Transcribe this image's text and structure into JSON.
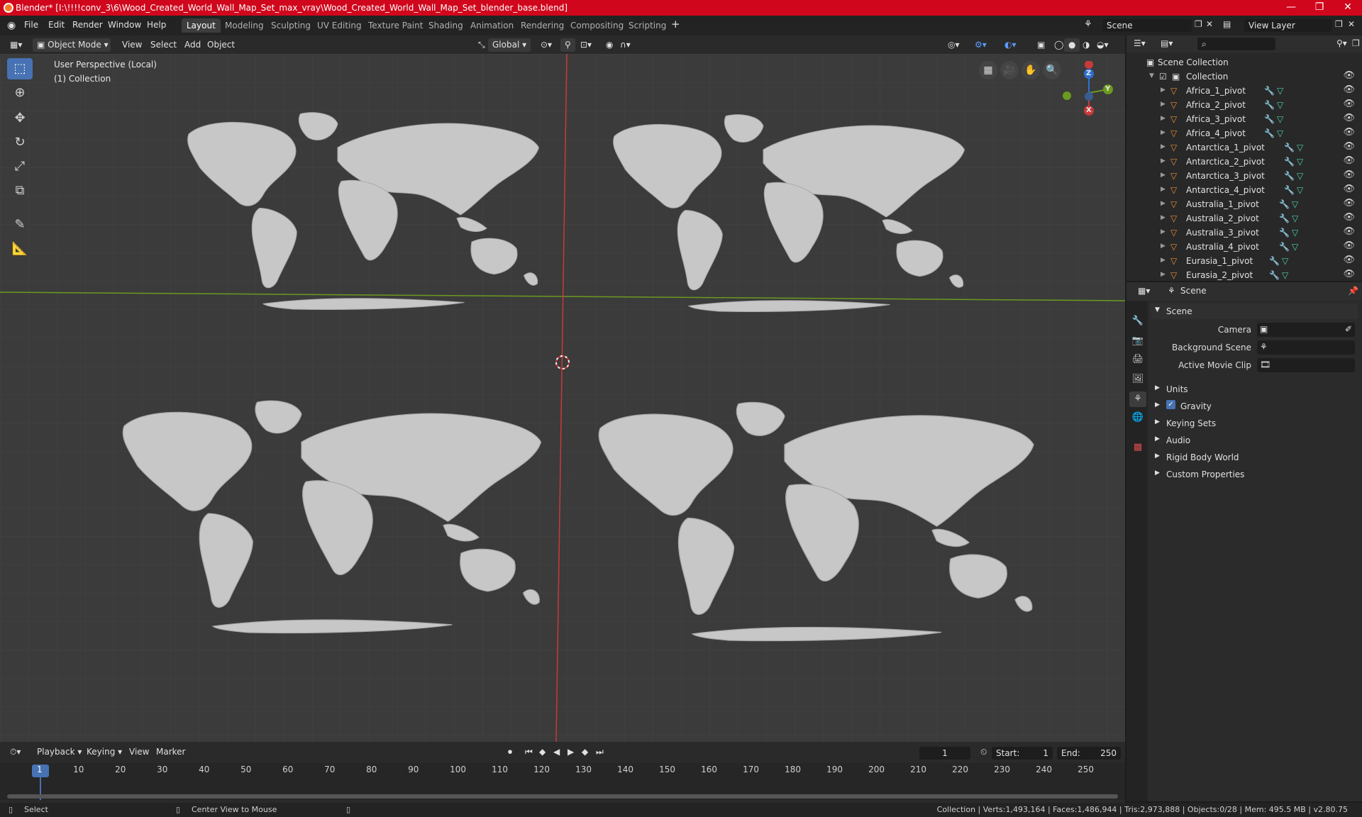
{
  "titlebar": {
    "title": "Blender* [I:\\!!!!conv_3\\6\\Wood_Created_World_Wall_Map_Set_max_vray\\Wood_Created_World_Wall_Map_Set_blender_base.blend]",
    "minimize": "—",
    "maximize": "❐",
    "close": "✕"
  },
  "menu": {
    "file": "File",
    "edit": "Edit",
    "render": "Render",
    "window": "Window",
    "help": "Help"
  },
  "workspaces": [
    "Layout",
    "Modeling",
    "Sculpting",
    "UV Editing",
    "Texture Paint",
    "Shading",
    "Animation",
    "Rendering",
    "Compositing",
    "Scripting"
  ],
  "scene_field": "Scene",
  "view_layer_field": "View Layer",
  "viewport_header": {
    "mode": "Object Mode",
    "view": "View",
    "select": "Select",
    "add": "Add",
    "object": "Object",
    "orientation": "Global"
  },
  "viewport": {
    "perspective_label": "User Perspective (Local)",
    "collection_label": "(1) Collection",
    "gizmo_z": "Z",
    "gizmo_y": "Y",
    "gizmo_x": "X"
  },
  "outliner": {
    "root": "Scene Collection",
    "collection": "Collection",
    "items": [
      "Africa_1_pivot",
      "Africa_2_pivot",
      "Africa_3_pivot",
      "Africa_4_pivot",
      "Antarctica_1_pivot",
      "Antarctica_2_pivot",
      "Antarctica_3_pivot",
      "Antarctica_4_pivot",
      "Australia_1_pivot",
      "Australia_2_pivot",
      "Australia_3_pivot",
      "Australia_4_pivot",
      "Eurasia_1_pivot",
      "Eurasia_2_pivot"
    ]
  },
  "properties": {
    "header": "Scene",
    "panel_scene": "Scene",
    "camera_label": "Camera",
    "background_scene_label": "Background Scene",
    "active_movie_clip_label": "Active Movie Clip",
    "panels": [
      "Units",
      "Gravity",
      "Keying Sets",
      "Audio",
      "Rigid Body World",
      "Custom Properties"
    ]
  },
  "timeline": {
    "playback": "Playback",
    "keying": "Keying",
    "view": "View",
    "marker": "Marker",
    "current_frame": "1",
    "start_label": "Start:",
    "start": "1",
    "end_label": "End:",
    "end": "250",
    "ticks": [
      "1",
      "10",
      "20",
      "30",
      "40",
      "50",
      "60",
      "70",
      "80",
      "90",
      "100",
      "110",
      "120",
      "130",
      "140",
      "150",
      "160",
      "170",
      "180",
      "190",
      "200",
      "210",
      "220",
      "230",
      "240",
      "250"
    ]
  },
  "statusbar": {
    "select": "Select",
    "center_view": "Center View to Mouse",
    "stats": "Collection | Verts:1,493,164 | Faces:1,486,944 | Tris:2,973,888 | Objects:0/28 | Mem: 495.5 MB | v2.80.75"
  },
  "colors": {
    "accent": "#4772b3",
    "title_red": "#d0061c",
    "x_axis": "#c83a3a",
    "y_axis": "#6b9a1f",
    "z_axis": "#2f6fd0",
    "map_fill": "#c7c7c7"
  }
}
